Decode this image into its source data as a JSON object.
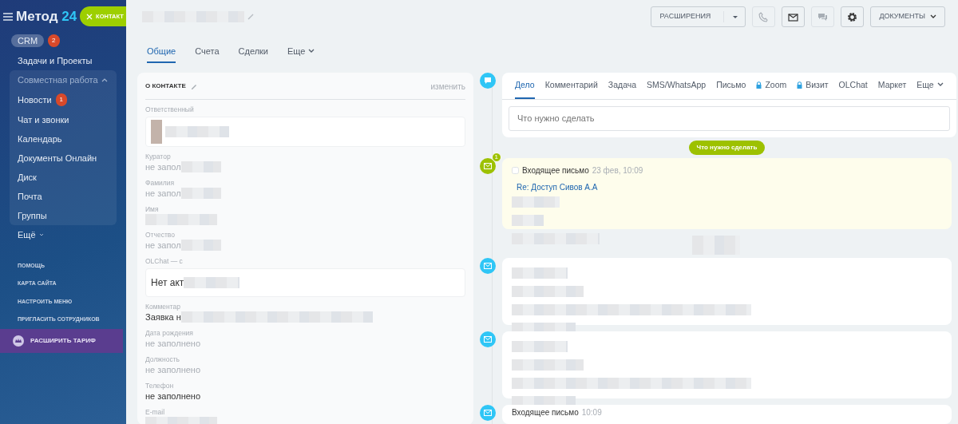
{
  "sidebar": {
    "logo": {
      "name": "Метод",
      "number": "24"
    },
    "close_button": {
      "label": "КОНТАКТ"
    },
    "items": [
      {
        "label": "CRM",
        "kind": "pill",
        "badge": "2"
      },
      {
        "label": "Задачи и Проекты",
        "kind": "link"
      },
      {
        "label": "Совместная работа",
        "kind": "group",
        "expanded": true,
        "children": [
          {
            "label": "Новости",
            "badge": "1"
          },
          {
            "label": "Чат и звонки"
          },
          {
            "label": "Календарь"
          },
          {
            "label": "Документы Онлайн"
          },
          {
            "label": "Диск"
          },
          {
            "label": "Почта"
          },
          {
            "label": "Группы"
          }
        ]
      },
      {
        "label": "Ещё",
        "kind": "more"
      }
    ],
    "links": [
      "ПОМОЩЬ",
      "КАРТА САЙТА",
      "НАСТРОИТЬ МЕНЮ",
      "ПРИГЛАСИТЬ СОТРУДНИКОВ"
    ],
    "upgrade": {
      "label": "РАСШИРИТЬ ТАРИФ"
    }
  },
  "header": {
    "buttons": [
      {
        "kind": "split",
        "label": "РАСШИРЕНИЯ"
      },
      {
        "kind": "phone",
        "disabled": true
      },
      {
        "kind": "mail",
        "disabled": false
      },
      {
        "kind": "chat",
        "disabled": true
      },
      {
        "kind": "gear",
        "disabled": false
      },
      {
        "kind": "dropdown",
        "label": "ДОКУМЕНТЫ"
      }
    ]
  },
  "tabs": [
    {
      "label": "Общие",
      "selected": true
    },
    {
      "label": "Счета",
      "selected": false
    },
    {
      "label": "Сделки",
      "selected": false
    },
    {
      "label": "Еще",
      "selected": false,
      "dropdown": true
    }
  ],
  "contact_card": {
    "title": "О КОНТАКТЕ",
    "edit_link": "изменить",
    "fields": [
      {
        "label": "Ответственный",
        "kind": "user"
      },
      {
        "label": "Куратор",
        "value": "не запол",
        "kind": "empty"
      },
      {
        "label": "Фамилия",
        "value": "не запол",
        "kind": "empty"
      },
      {
        "label": "Имя",
        "kind": "hidden"
      },
      {
        "label": "Отчество",
        "value": "не запол",
        "kind": "empty"
      },
      {
        "label": "OLChat — с",
        "value": "Нет акт",
        "kind": "box"
      },
      {
        "label": "Комментар",
        "value": "Заявка н",
        "kind": "filled"
      },
      {
        "label": "Дата рождения",
        "value": "не заполнено",
        "kind": "empty"
      },
      {
        "label": "Должность",
        "value": "не заполнено",
        "kind": "empty"
      },
      {
        "label": "Телефон",
        "value": "не заполнено",
        "kind": "filled"
      },
      {
        "label": "E-mail",
        "kind": "hidden"
      }
    ]
  },
  "activity_editor": {
    "tabs": [
      {
        "label": "Дело",
        "selected": true,
        "locked": false
      },
      {
        "label": "Комментарий",
        "selected": false,
        "locked": false
      },
      {
        "label": "Задача",
        "selected": false,
        "locked": false
      },
      {
        "label": "SMS/WhatsApp",
        "selected": false,
        "locked": false
      },
      {
        "label": "Письмо",
        "selected": false,
        "locked": false
      },
      {
        "label": "Zoom",
        "selected": false,
        "locked": true
      },
      {
        "label": "Визит",
        "selected": false,
        "locked": true
      },
      {
        "label": "OLChat",
        "selected": false,
        "locked": false
      },
      {
        "label": "Маркет",
        "selected": false,
        "locked": false
      },
      {
        "label": "Еще",
        "selected": false,
        "locked": false,
        "dropdown": true
      }
    ],
    "input": {
      "placeholder": "Что нужно сделать"
    }
  },
  "timeline": {
    "section_label": "Что нужно сделать",
    "items": [
      {
        "kind": "planned",
        "badge": "1",
        "title": "Входящее письмо",
        "time": "23 фев, 10:09",
        "subject": "Re: Доступ Сивов А.А",
        "checked": false
      },
      {
        "kind": "separator"
      },
      {
        "kind": "history"
      },
      {
        "kind": "history"
      },
      {
        "kind": "history",
        "title": "Входящее письмо",
        "time": "10:09"
      }
    ]
  }
}
